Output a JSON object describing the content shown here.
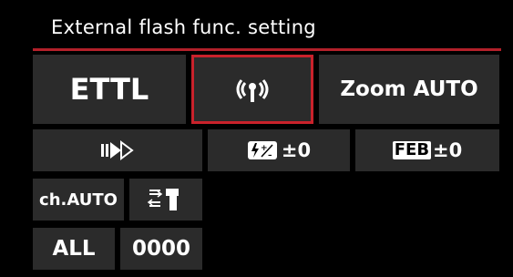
{
  "screen": {
    "title": "External flash func. setting"
  },
  "grid": {
    "flash_mode": "ETTL",
    "wireless_icon": "wireless-antenna-icon",
    "zoom_label": "Zoom AUTO",
    "sync_icon": "high-speed-sync-icon",
    "fec_icon_label": "⚡±",
    "fec_value": "±0",
    "feb_badge": "FEB",
    "feb_value": "±0",
    "channel_label": "ch.AUTO",
    "transmit_icon": "wireless-transmission-icon",
    "group_label": "ALL",
    "id_label": "0000"
  },
  "colors": {
    "background": "#000000",
    "cell": "#2b2b2b",
    "accent_red": "#c9222b",
    "text": "#ffffff"
  }
}
